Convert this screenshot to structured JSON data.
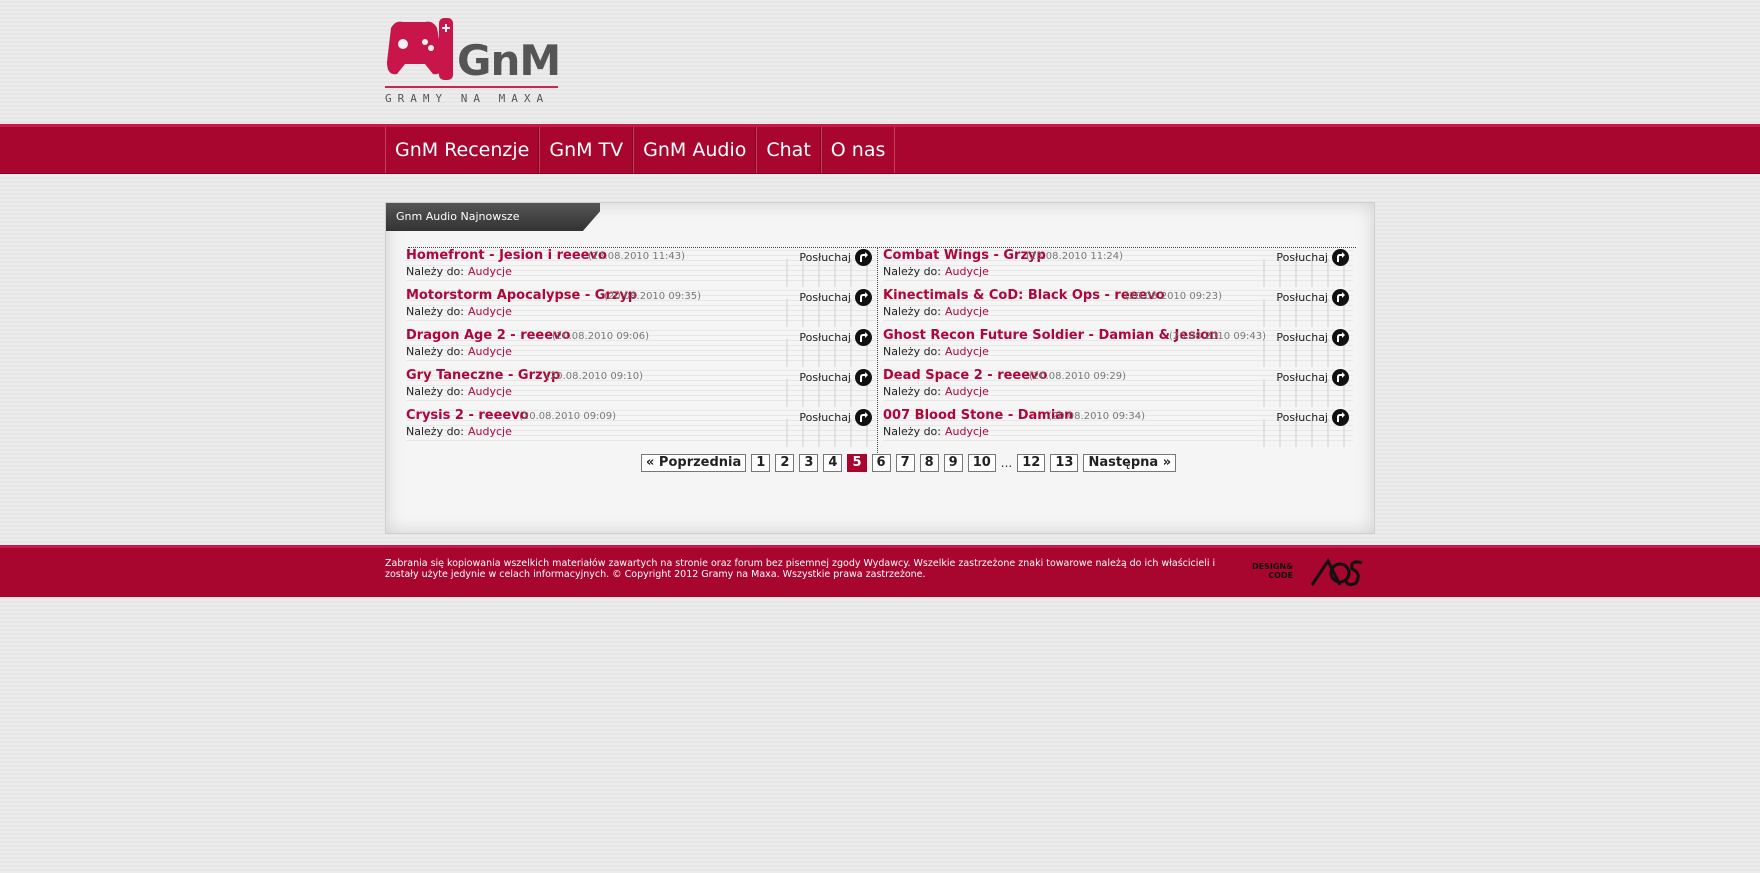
{
  "logo": {
    "wordmark": "GnM",
    "tagline": "GRAMY NA MAXA"
  },
  "nav": {
    "items": [
      "GnM Recenzje",
      "GnM TV",
      "GnM Audio",
      "Chat",
      "O nas"
    ]
  },
  "box": {
    "heading": "Gnm Audio Najnowsze"
  },
  "listen_label": "Posłuchaj",
  "belongs_label": "Należy do:",
  "left_items": [
    {
      "title": "Homefront - Jesion i reeevo",
      "date": "(23.08.2010 11:43)",
      "category": "Audycje"
    },
    {
      "title": "Motorstorm Apocalypse - Grzyp",
      "date": "(20.08.2010 09:35)",
      "category": "Audycje"
    },
    {
      "title": "Dragon Age 2 - reeevo",
      "date": "(20.08.2010 09:06)",
      "category": "Audycje"
    },
    {
      "title": "Gry Taneczne - Grzyp",
      "date": "(20.08.2010 09:10)",
      "category": "Audycje"
    },
    {
      "title": "Crysis 2 - reeevo",
      "date": "(20.08.2010 09:09)",
      "category": "Audycje"
    }
  ],
  "right_items": [
    {
      "title": "Combat Wings - Grzyp",
      "date": "(23.08.2010 11:24)",
      "category": "Audycje"
    },
    {
      "title": "Kinectimals & CoD: Black Ops - reeevo",
      "date": "(20.08.2010 09:23)",
      "category": "Audycje"
    },
    {
      "title": "Ghost Recon Future Soldier - Damian & Jesion",
      "date": "(20.08.2010 09:43)",
      "category": "Audycje"
    },
    {
      "title": "Dead Space 2 - reeevo",
      "date": "(20.08.2010 09:29)",
      "category": "Audycje"
    },
    {
      "title": "007 Blood Stone - Damian",
      "date": "(20.08.2010 09:34)",
      "category": "Audycje"
    }
  ],
  "pagination": {
    "prev": "« Poprzednia",
    "pages": [
      "1",
      "2",
      "3",
      "4",
      "5",
      "6",
      "7",
      "8",
      "9",
      "10"
    ],
    "ellipsis": "...",
    "tail": [
      "12",
      "13"
    ],
    "current": "5",
    "next": "Następna »"
  },
  "footer": {
    "text": "Zabrania się kopiowania wszelkich materiałów zawartych na stronie oraz forum bez pisemnej zgody Wydawcy. Wszelkie zastrzeżone znaki towarowe należą do ich właścicieli i zostały użyte jedynie w celach informacyjnych. © Copyright 2012 Gramy na Maxa. Wszystkie prawa zastrzeżone.",
    "design_line1": "DESIGN&",
    "design_line2": "CODE"
  },
  "colors": {
    "brand": "#a8052f",
    "link": "#b0053a"
  }
}
